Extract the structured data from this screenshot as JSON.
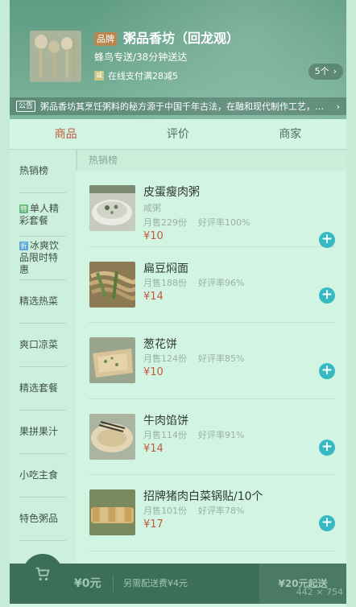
{
  "shop": {
    "brand_badge": "品牌",
    "name": "粥品香坊（回龙观）",
    "delivery": "蜂鸟专送/38分钟送达",
    "promo_icon": "减",
    "promo": "在线支付满28减5",
    "promo_count": "5个",
    "count_arrow": "›",
    "bulletin_badge": "公告",
    "bulletin": "粥品香坊其烹饪粥料的秘方源于中国千年古法，在融和现代制作工艺，由世界烹饪大师屈浩先生领衔研发。",
    "bulletin_arrow": "›"
  },
  "tabs": [
    {
      "label": "商品",
      "active": true
    },
    {
      "label": "评价",
      "active": false
    },
    {
      "label": "商家",
      "active": false
    }
  ],
  "sidebar": {
    "items": [
      {
        "label": "热销榜",
        "icon": ""
      },
      {
        "label": "单人精彩套餐",
        "icon": "特",
        "icon_color": "#6ab879"
      },
      {
        "label": "冰爽饮品限时特惠",
        "icon": "折",
        "icon_color": "#58aadc"
      },
      {
        "label": "精选热菜",
        "icon": ""
      },
      {
        "label": "爽口凉菜",
        "icon": ""
      },
      {
        "label": "精选套餐",
        "icon": ""
      },
      {
        "label": "果拼果汁",
        "icon": ""
      },
      {
        "label": "小吃主食",
        "icon": ""
      },
      {
        "label": "特色粥品",
        "icon": ""
      }
    ]
  },
  "menu": {
    "section_title": "热销榜",
    "items": [
      {
        "name": "皮蛋瘦肉粥",
        "desc": "咸粥",
        "sales": "月售229份",
        "rating": "好评率100%",
        "price": "¥10"
      },
      {
        "name": "扁豆焖面",
        "desc": "",
        "sales": "月售188份",
        "rating": "好评率96%",
        "price": "¥14"
      },
      {
        "name": "葱花饼",
        "desc": "",
        "sales": "月售124份",
        "rating": "好评率85%",
        "price": "¥10"
      },
      {
        "name": "牛肉馅饼",
        "desc": "",
        "sales": "月售114份",
        "rating": "好评率91%",
        "price": "¥14"
      },
      {
        "name": "招牌猪肉白菜锅贴/10个",
        "desc": "",
        "sales": "月售101份",
        "rating": "好评率78%",
        "price": "¥17"
      }
    ],
    "add_symbol": "+"
  },
  "cart": {
    "total": "¥0元",
    "delivery_fee": "另需配送费¥4元",
    "checkout": "¥20元起送",
    "size_tag": "442 × 754"
  },
  "colors": {
    "accent": "#c35a3e",
    "add_button": "#37b9c4",
    "cart_bar": "#3d6f58"
  }
}
